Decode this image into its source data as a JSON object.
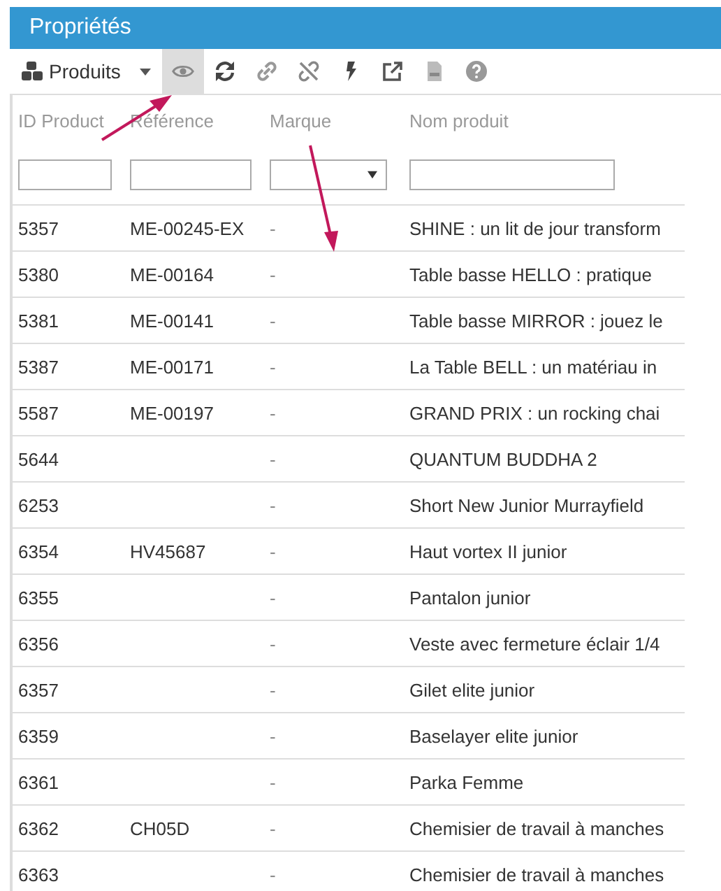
{
  "panel": {
    "title": "Propriétés"
  },
  "toolbar": [
    {
      "kind": "dropdown",
      "label": "Produits",
      "selected": false
    },
    {
      "kind": "eye",
      "selected": true
    },
    {
      "kind": "refresh",
      "selected": false
    },
    {
      "kind": "link",
      "selected": false
    },
    {
      "kind": "unlink",
      "selected": false
    },
    {
      "kind": "bolt",
      "selected": false
    },
    {
      "kind": "external",
      "selected": false
    },
    {
      "kind": "csv",
      "selected": false
    },
    {
      "kind": "help",
      "selected": false
    }
  ],
  "table": {
    "columns": [
      {
        "label": "ID Product",
        "kind": "text"
      },
      {
        "label": "Référence",
        "kind": "text"
      },
      {
        "label": "Marque",
        "kind": "select"
      },
      {
        "label": "Nom produit",
        "kind": "text"
      }
    ],
    "rows": [
      [
        "5357",
        "ME-00245-EX",
        "-",
        "SHINE : un lit de jour transform"
      ],
      [
        "5380",
        "ME-00164",
        "-",
        "Table basse HELLO : pratique"
      ],
      [
        "5381",
        "ME-00141",
        "-",
        "Table basse MIRROR : jouez le"
      ],
      [
        "5387",
        "ME-00171",
        "-",
        "La Table BELL : un matériau in"
      ],
      [
        "5587",
        "ME-00197",
        "-",
        "GRAND PRIX : un rocking chai"
      ],
      [
        "5644",
        "",
        "-",
        "QUANTUM BUDDHA 2"
      ],
      [
        "6253",
        "",
        "-",
        "Short New Junior Murrayfield"
      ],
      [
        "6354",
        "HV45687",
        "-",
        "Haut vortex II junior"
      ],
      [
        "6355",
        "",
        "-",
        "Pantalon junior"
      ],
      [
        "6356",
        "",
        "-",
        "Veste avec fermeture éclair 1/4"
      ],
      [
        "6357",
        "",
        "-",
        "Gilet elite junior"
      ],
      [
        "6359",
        "",
        "-",
        "Baselayer elite junior"
      ],
      [
        "6361",
        "",
        "-",
        "Parka Femme"
      ],
      [
        "6362",
        "CH05D",
        "-",
        "Chemisier de travail à manches"
      ],
      [
        "6363",
        "",
        "-",
        "Chemisier de travail à manches"
      ]
    ]
  }
}
